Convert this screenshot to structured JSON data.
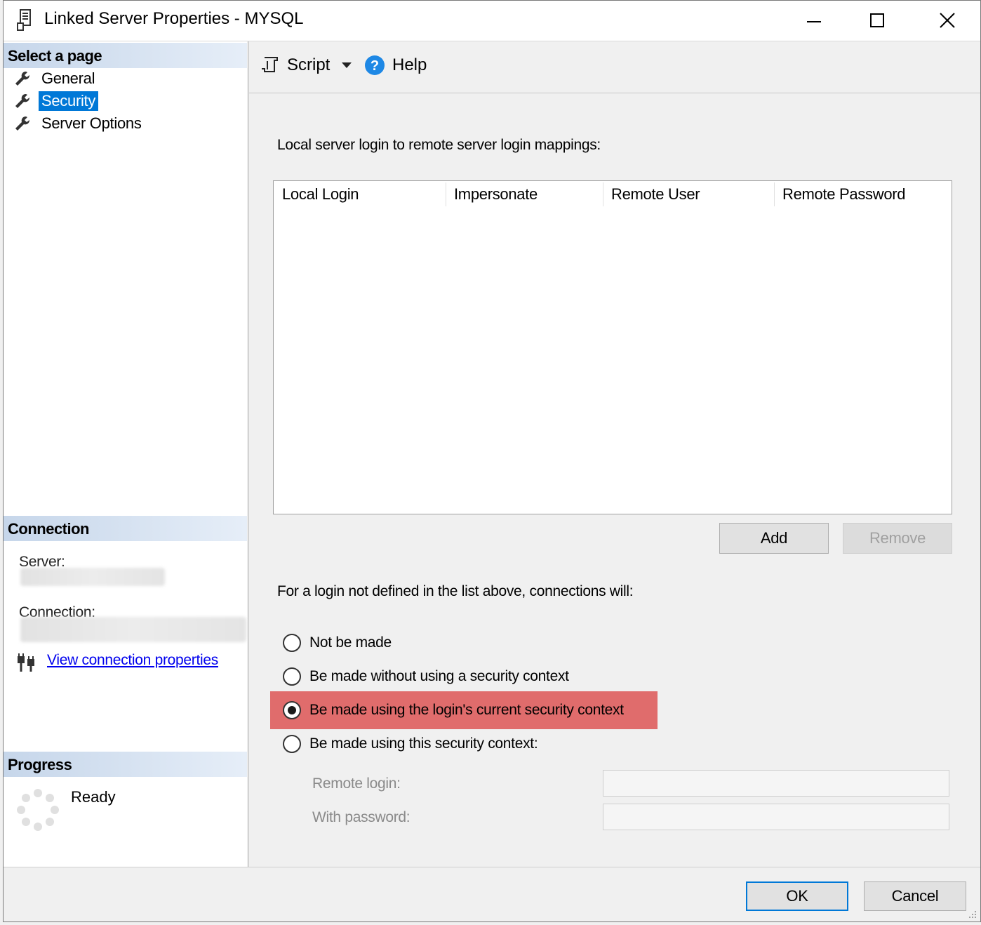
{
  "window": {
    "title": "Linked Server Properties - MYSQL"
  },
  "left_pane": {
    "select_page_header": "Select a page",
    "pages": [
      {
        "label": "General",
        "selected": false
      },
      {
        "label": "Security",
        "selected": true
      },
      {
        "label": "Server Options",
        "selected": false
      }
    ],
    "connection_header": "Connection",
    "server_label": "Server:",
    "connection_label": "Connection:",
    "view_connection_link": "View connection properties",
    "progress_header": "Progress",
    "progress_status": "Ready"
  },
  "toolbar": {
    "script_label": "Script",
    "help_label": "Help"
  },
  "security": {
    "mappings_label": "Local server login to remote server login mappings:",
    "columns": [
      "Local Login",
      "Impersonate",
      "Remote User",
      "Remote Password"
    ],
    "add_button": "Add",
    "remove_button": "Remove",
    "fallback_label": "For a login not defined in the list above, connections will:",
    "options": [
      {
        "label": "Not be made",
        "checked": false
      },
      {
        "label": "Be made without using a security context",
        "checked": false
      },
      {
        "label": "Be made using the login's current security context",
        "checked": true
      },
      {
        "label": "Be made using this security context:",
        "checked": false
      }
    ],
    "remote_login_label": "Remote login:",
    "remote_login_value": "",
    "with_password_label": "With password:",
    "with_password_value": ""
  },
  "footer": {
    "ok_button": "OK",
    "cancel_button": "Cancel"
  },
  "colors": {
    "selection": "#0078d7",
    "highlight": "#e06c6c",
    "link": "#0000ee"
  }
}
